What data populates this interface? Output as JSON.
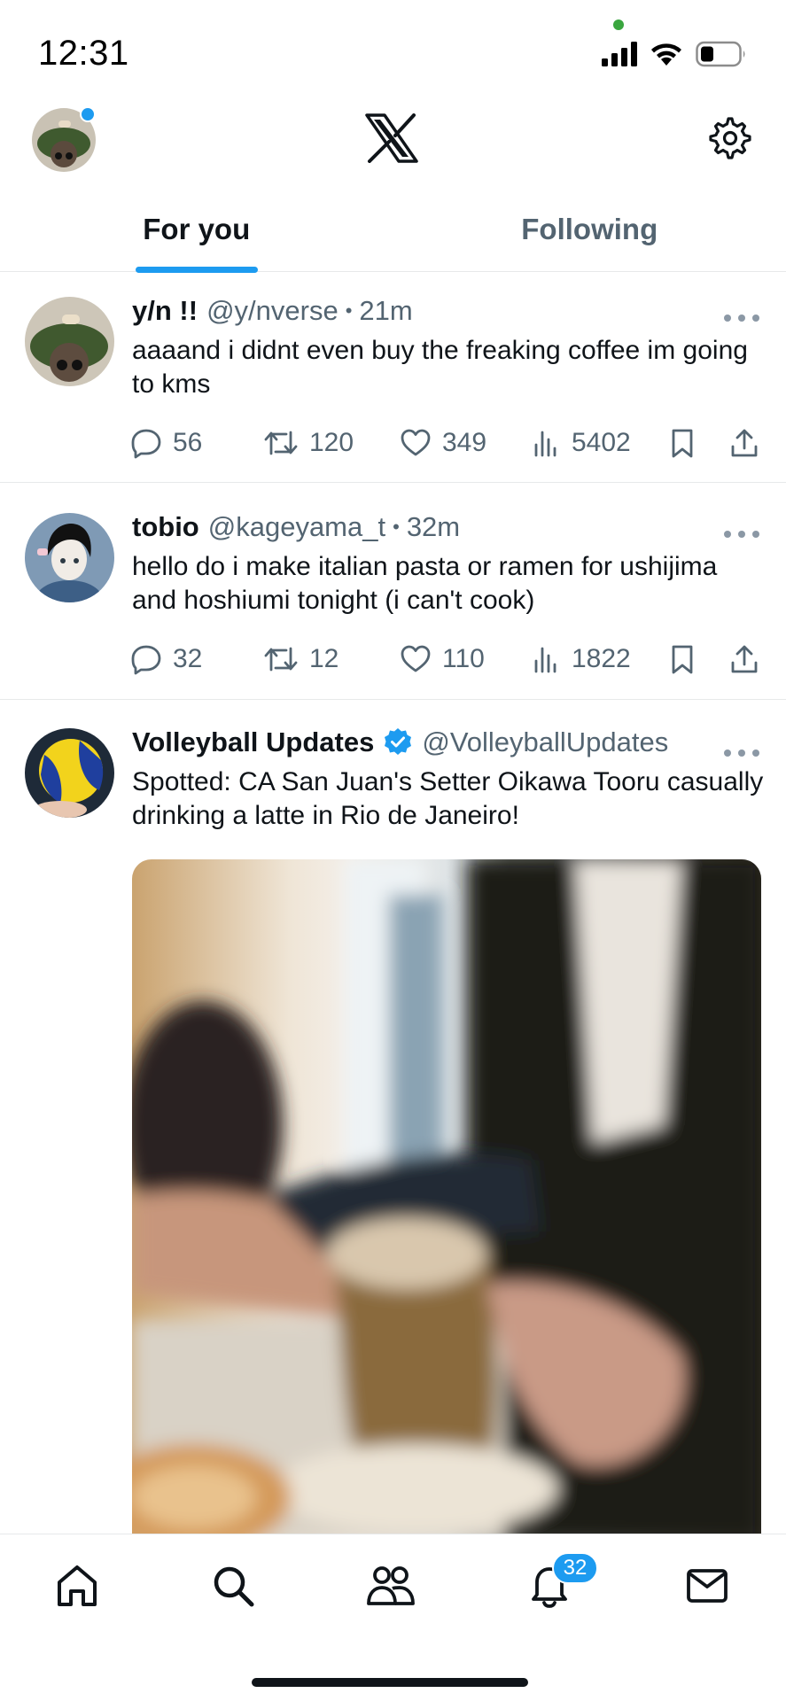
{
  "status_bar": {
    "time": "12:31"
  },
  "header": {
    "logo_icon": "x-logo-icon",
    "settings_icon": "gear-icon"
  },
  "tabs": [
    {
      "label": "For you",
      "active": true
    },
    {
      "label": "Following",
      "active": false
    }
  ],
  "tweets": [
    {
      "name": "y/n !!",
      "handle": "@y/nverse",
      "time": "21m",
      "verified": false,
      "text": "aaaand i didnt even buy the freaking coffee im going to kms",
      "replies": "56",
      "retweets": "120",
      "likes": "349",
      "views": "5402"
    },
    {
      "name": "tobio",
      "handle": "@kageyama_t",
      "time": "32m",
      "verified": false,
      "text": "hello do i make italian pasta or ramen for ushijima and hoshiumi tonight (i can't cook)",
      "replies": "32",
      "retweets": "12",
      "likes": "110",
      "views": "1822"
    },
    {
      "name": "Volleyball Updates",
      "handle": "@VolleyballUpdates",
      "verified": true,
      "text": "Spotted: CA San Juan's Setter Oikawa Tooru casually drinking a latte in Rio de Janeiro!",
      "media": "blurred-photo-hands-holding-latte-mug"
    }
  ],
  "bottom_nav": {
    "items": [
      "home-icon",
      "search-icon",
      "communities-icon",
      "bell-icon",
      "mail-icon"
    ],
    "notification_count": "32"
  },
  "colors": {
    "accent": "#1d9bf0",
    "text_primary": "#0f1419",
    "text_secondary": "#536471",
    "divider": "#e7e9ea"
  }
}
